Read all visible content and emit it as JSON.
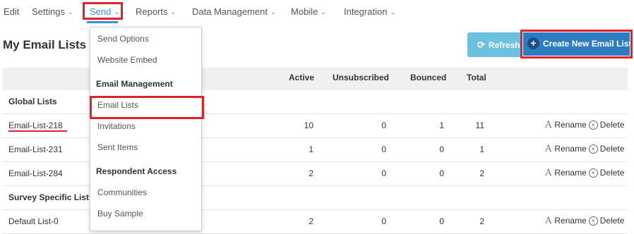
{
  "nav": {
    "items": [
      {
        "label": "Edit",
        "has_chevron": false
      },
      {
        "label": "Settings",
        "has_chevron": true
      },
      {
        "label": "Send",
        "has_chevron": true
      },
      {
        "label": "Reports",
        "has_chevron": true
      },
      {
        "label": "Data Management",
        "has_chevron": true
      },
      {
        "label": "Mobile",
        "has_chevron": true
      },
      {
        "label": "Integration",
        "has_chevron": true
      }
    ],
    "active": "Send"
  },
  "page": {
    "title": "My Email Lists"
  },
  "buttons": {
    "refresh": "Refresh",
    "create": "Create New Email List"
  },
  "table": {
    "headers": {
      "active": "Active",
      "unsubscribed": "Unsubscribed",
      "bounced": "Bounced",
      "total": "Total"
    },
    "groups": {
      "global": "Global Lists",
      "survey": "Survey Specific Lists"
    },
    "rows": [
      {
        "name": "Email-List-218",
        "active": "10",
        "unsubscribed": "0",
        "bounced": "1",
        "total": "11"
      },
      {
        "name": "Email-List-231",
        "active": "1",
        "unsubscribed": "0",
        "bounced": "0",
        "total": "1"
      },
      {
        "name": "Email-List-284",
        "active": "2",
        "unsubscribed": "0",
        "bounced": "0",
        "total": "2"
      },
      {
        "name": "Default List-0",
        "active": "2",
        "unsubscribed": "0",
        "bounced": "0",
        "total": "2"
      }
    ],
    "actions": {
      "rename": "Rename",
      "delete": "Delete"
    }
  },
  "dropdown": {
    "items": [
      "Send Options",
      "Website Embed"
    ],
    "section_email": "Email Management",
    "email_items": [
      "Email Lists",
      "Invitations",
      "Sent Items"
    ],
    "section_respondent": "Respondent Access",
    "respondent_items": [
      "Communities",
      "Buy Sample"
    ],
    "highlighted": "Email Lists"
  },
  "icons": {
    "chevron": "chevron-down-icon",
    "refresh": "refresh-icon",
    "plus": "plus-circle-icon",
    "rename": "font-a-icon",
    "delete": "x-circle-icon"
  },
  "colors": {
    "highlight": "#e0212b",
    "primary": "#2d7cc2",
    "info": "#6cc2de",
    "active_underline": "#3a8fd6"
  }
}
